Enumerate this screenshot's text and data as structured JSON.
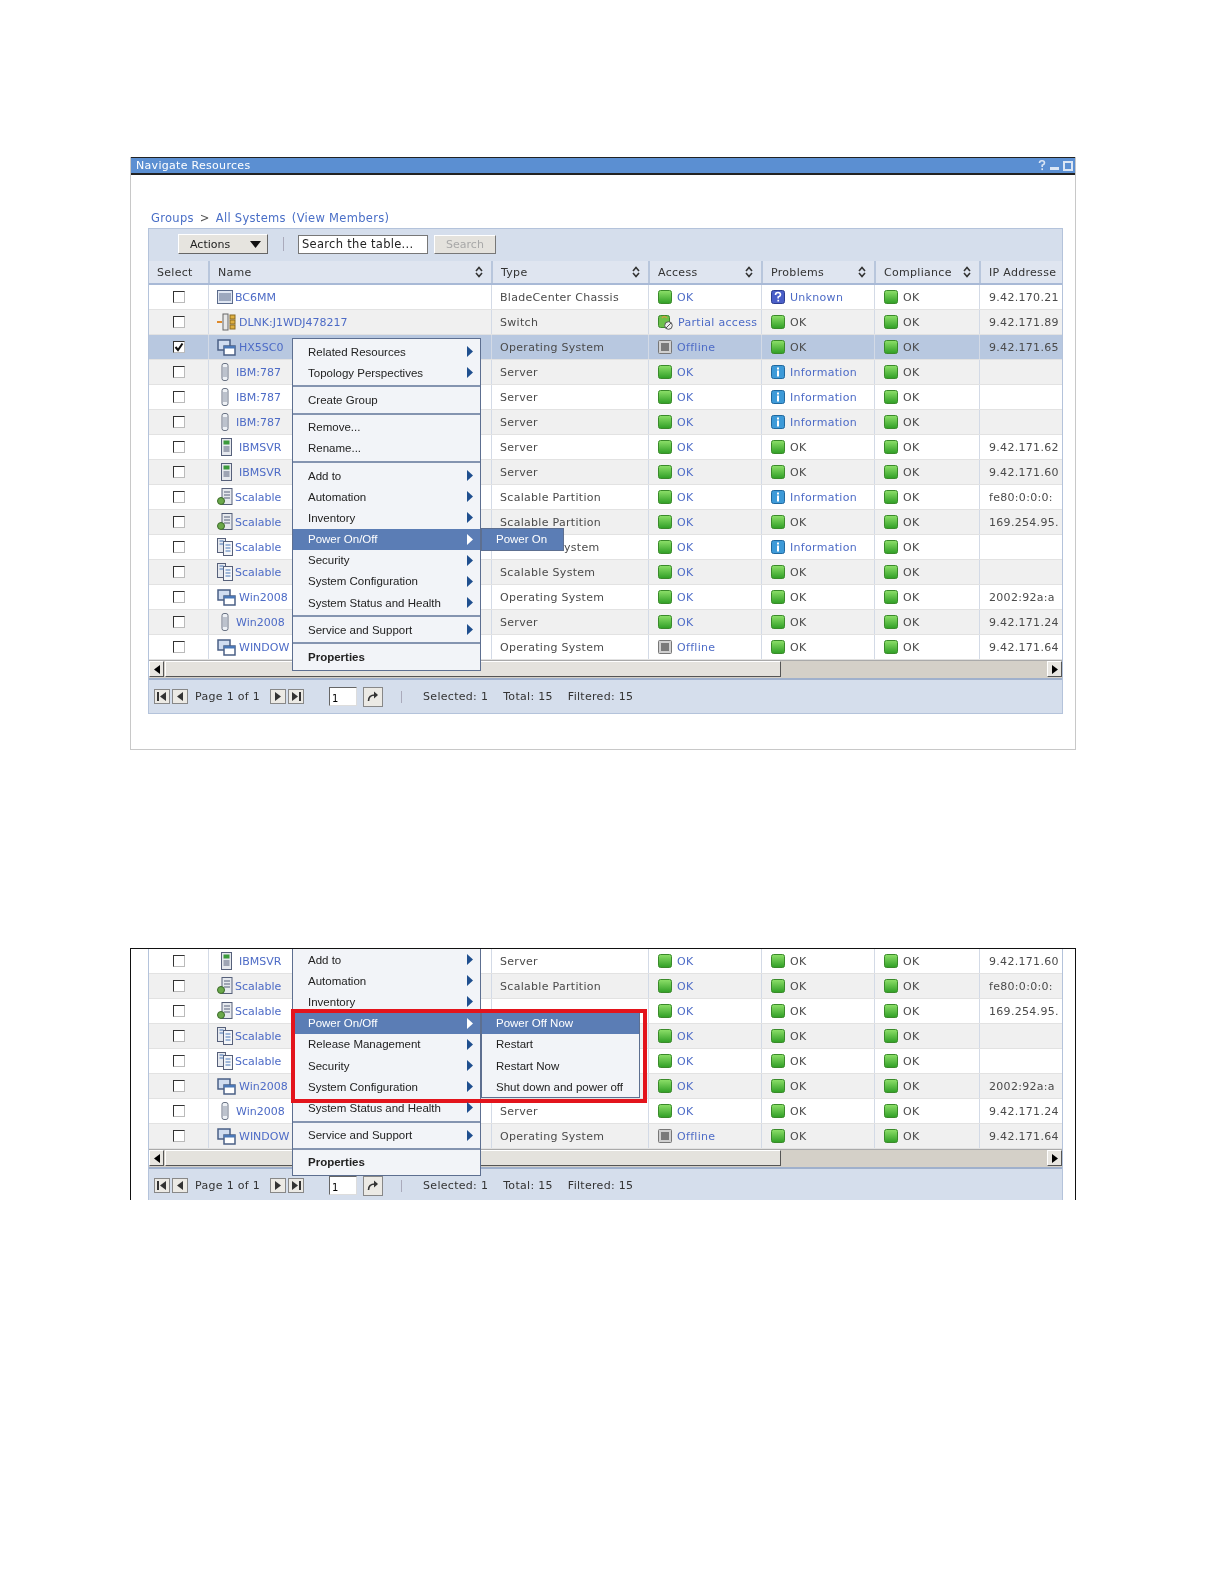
{
  "screens": [
    {
      "window": {
        "title": "Navigate Resources"
      },
      "breadcrumb": [
        {
          "text": "Groups",
          "link": true
        },
        {
          "text": ">",
          "link": false
        },
        {
          "text": "All Systems",
          "link": true
        },
        {
          "text": "(View Members)",
          "link": true
        }
      ],
      "toolbar": {
        "actions": "Actions",
        "search": {
          "placeholder": "Search the table..."
        },
        "search_button": {
          "label": "Search",
          "disabled": true
        }
      },
      "columns": [
        {
          "label": "Select",
          "sortable": false
        },
        {
          "label": "Name",
          "sortable": true
        },
        {
          "label": "Type",
          "sortable": true
        },
        {
          "label": "Access",
          "sortable": true
        },
        {
          "label": "Problems",
          "sortable": true
        },
        {
          "label": "Compliance",
          "sortable": true
        },
        {
          "label": "IP Addresse"
        }
      ],
      "rows": [
        {
          "kind": "chassis",
          "selected": false,
          "name": "BC6MM",
          "type": "BladeCenter Chassis",
          "access": {
            "kind": "ok",
            "text": "OK"
          },
          "problems": {
            "kind": "unknown",
            "text": "Unknown"
          },
          "compliance": {
            "kind": "ok",
            "text": "OK"
          },
          "ip": "9.42.170.21"
        },
        {
          "kind": "switch",
          "selected": false,
          "name": "DLNK:J1WDJ478217",
          "type": "Switch",
          "access": {
            "kind": "partial",
            "text": "Partial access"
          },
          "problems": {
            "kind": "ok",
            "text": "OK"
          },
          "compliance": {
            "kind": "ok",
            "text": "OK"
          },
          "ip": "9.42.171.89"
        },
        {
          "kind": "os",
          "selected": true,
          "name": "HX5SC0",
          "type": "Operating System",
          "access": {
            "kind": "offline",
            "text": "Offline"
          },
          "problems": {
            "kind": "ok",
            "text": "OK"
          },
          "compliance": {
            "kind": "ok",
            "text": "OK"
          },
          "ip": "9.42.171.65"
        },
        {
          "kind": "blade",
          "selected": false,
          "name": "IBM:787",
          "type": "Server",
          "access": {
            "kind": "ok",
            "text": "OK"
          },
          "problems": {
            "kind": "info",
            "text": "Information"
          },
          "compliance": {
            "kind": "ok",
            "text": "OK"
          }
        },
        {
          "kind": "blade",
          "selected": false,
          "name": "IBM:787",
          "type": "Server",
          "access": {
            "kind": "ok",
            "text": "OK"
          },
          "problems": {
            "kind": "info",
            "text": "Information"
          },
          "compliance": {
            "kind": "ok",
            "text": "OK"
          }
        },
        {
          "kind": "blade",
          "selected": false,
          "name": "IBM:787",
          "type": "Server",
          "access": {
            "kind": "ok",
            "text": "OK"
          },
          "problems": {
            "kind": "info",
            "text": "Information"
          },
          "compliance": {
            "kind": "ok",
            "text": "OK"
          }
        },
        {
          "kind": "tower",
          "selected": false,
          "name": "IBMSVR",
          "type": "Server",
          "access": {
            "kind": "ok",
            "text": "OK"
          },
          "problems": {
            "kind": "ok",
            "text": "OK"
          },
          "compliance": {
            "kind": "ok",
            "text": "OK"
          },
          "ip": "9.42.171.62"
        },
        {
          "kind": "tower",
          "selected": false,
          "name": "IBMSVR",
          "type": "Server",
          "access": {
            "kind": "ok",
            "text": "OK"
          },
          "problems": {
            "kind": "ok",
            "text": "OK"
          },
          "compliance": {
            "kind": "ok",
            "text": "OK"
          },
          "ip": "9.42.171.60"
        },
        {
          "kind": "partition",
          "selected": false,
          "name": "Scalable",
          "type": "Scalable Partition",
          "access": {
            "kind": "ok",
            "text": "OK"
          },
          "problems": {
            "kind": "info",
            "text": "Information"
          },
          "compliance": {
            "kind": "ok",
            "text": "OK"
          },
          "ip": "fe80:0:0:0:"
        },
        {
          "kind": "partition",
          "selected": false,
          "name": "Scalable",
          "type": "Scalable Partition",
          "access": {
            "kind": "ok",
            "text": "OK"
          },
          "problems": {
            "kind": "ok",
            "text": "OK"
          },
          "compliance": {
            "kind": "ok",
            "text": "OK"
          },
          "ip": "169.254.95."
        },
        {
          "kind": "system",
          "selected": false,
          "name": "Scalable",
          "type": "ystem",
          "type_partly_covered": true,
          "access": {
            "kind": "ok",
            "text": "OK"
          },
          "problems": {
            "kind": "info",
            "text": "Information"
          },
          "compliance": {
            "kind": "ok",
            "text": "OK"
          }
        },
        {
          "kind": "system",
          "selected": false,
          "name": "Scalable",
          "type": "Scalable System",
          "access": {
            "kind": "ok",
            "text": "OK"
          },
          "problems": {
            "kind": "ok",
            "text": "OK"
          },
          "compliance": {
            "kind": "ok",
            "text": "OK"
          }
        },
        {
          "kind": "os",
          "selected": false,
          "name": "Win2008",
          "type": "Operating System",
          "access": {
            "kind": "ok",
            "text": "OK"
          },
          "problems": {
            "kind": "ok",
            "text": "OK"
          },
          "compliance": {
            "kind": "ok",
            "text": "OK"
          },
          "ip": "2002:92a:a"
        },
        {
          "kind": "blade",
          "selected": false,
          "name": "Win2008",
          "type": "Server",
          "access": {
            "kind": "ok",
            "text": "OK"
          },
          "problems": {
            "kind": "ok",
            "text": "OK"
          },
          "compliance": {
            "kind": "ok",
            "text": "OK"
          },
          "ip": "9.42.171.24"
        },
        {
          "kind": "os",
          "selected": false,
          "name": "WINDOW",
          "type": "Operating System",
          "access": {
            "kind": "offline",
            "text": "Offline"
          },
          "problems": {
            "kind": "ok",
            "text": "OK"
          },
          "compliance": {
            "kind": "ok",
            "text": "OK"
          },
          "ip": "9.42.171.64"
        }
      ],
      "menu": {
        "highlight": false,
        "sections": [
          [
            {
              "label": "Related Resources",
              "has_submenu": true,
              "selected": false,
              "default": false
            },
            {
              "label": "Topology Perspectives",
              "has_submenu": true,
              "selected": false,
              "default": false
            }
          ],
          [
            {
              "label": "Create Group",
              "has_submenu": false,
              "selected": false,
              "default": false
            }
          ],
          [
            {
              "label": "Remove...",
              "has_submenu": false,
              "selected": false,
              "default": false
            },
            {
              "label": "Rename...",
              "has_submenu": false,
              "selected": false,
              "default": false
            }
          ],
          [
            {
              "label": "Add to",
              "has_submenu": true,
              "selected": false,
              "default": false
            },
            {
              "label": "Automation",
              "has_submenu": true,
              "selected": false,
              "default": false
            },
            {
              "label": "Inventory",
              "has_submenu": true,
              "selected": false,
              "default": false
            },
            {
              "label": "Power On/Off",
              "has_submenu": true,
              "selected": true,
              "default": false
            },
            {
              "label": "Security",
              "has_submenu": true,
              "selected": false,
              "default": false
            },
            {
              "label": "System Configuration",
              "has_submenu": true,
              "selected": false,
              "default": false
            },
            {
              "label": "System Status and Health",
              "has_submenu": true,
              "selected": false,
              "default": false
            }
          ],
          [
            {
              "label": "Service and Support",
              "has_submenu": true,
              "selected": false,
              "default": false
            }
          ],
          [
            {
              "label": "Properties",
              "has_submenu": false,
              "selected": false,
              "default": true
            }
          ]
        ],
        "submenu": [
          {
            "label": "Power On",
            "selected": true
          }
        ]
      },
      "pager": {
        "page_label": "Page 1 of 1",
        "page_value": "1",
        "selected_count": "Selected: 1",
        "total": "Total: 15",
        "filtered": "Filtered: 15"
      }
    },
    {
      "rows": [
        {
          "kind": "tower",
          "selected": false,
          "name": "IBMSVR",
          "type": "Server",
          "access": {
            "kind": "ok",
            "text": "OK"
          },
          "problems": {
            "kind": "ok",
            "text": "OK"
          },
          "compliance": {
            "kind": "ok",
            "text": "OK"
          },
          "ip": "9.42.171.60"
        },
        {
          "kind": "partition",
          "selected": false,
          "name": "Scalable",
          "type": "Scalable Partition",
          "access": {
            "kind": "ok",
            "text": "OK"
          },
          "problems": {
            "kind": "ok",
            "text": "OK"
          },
          "compliance": {
            "kind": "ok",
            "text": "OK"
          },
          "ip": "fe80:0:0:0:"
        },
        {
          "kind": "partition",
          "selected": false,
          "name": "Scalable",
          "access": {
            "kind": "ok",
            "text": "OK"
          },
          "problems": {
            "kind": "ok",
            "text": "OK"
          },
          "compliance": {
            "kind": "ok",
            "text": "OK"
          },
          "ip": "169.254.95."
        },
        {
          "kind": "system",
          "selected": false,
          "name": "Scalable",
          "access": {
            "kind": "ok",
            "text": "OK"
          },
          "problems": {
            "kind": "ok",
            "text": "OK"
          },
          "compliance": {
            "kind": "ok",
            "text": "OK"
          }
        },
        {
          "kind": "system",
          "selected": false,
          "name": "Scalable",
          "access": {
            "kind": "ok",
            "text": "OK"
          },
          "problems": {
            "kind": "ok",
            "text": "OK"
          },
          "compliance": {
            "kind": "ok",
            "text": "OK"
          }
        },
        {
          "kind": "os",
          "selected": false,
          "name": "Win2008",
          "access": {
            "kind": "ok",
            "text": "OK"
          },
          "problems": {
            "kind": "ok",
            "text": "OK"
          },
          "compliance": {
            "kind": "ok",
            "text": "OK"
          },
          "ip": "2002:92a:a"
        },
        {
          "kind": "blade",
          "selected": false,
          "name": "Win2008",
          "type": "Server",
          "access": {
            "kind": "ok",
            "text": "OK"
          },
          "problems": {
            "kind": "ok",
            "text": "OK"
          },
          "compliance": {
            "kind": "ok",
            "text": "OK"
          },
          "ip": "9.42.171.24"
        },
        {
          "kind": "os",
          "selected": false,
          "name": "WINDOW",
          "type": "Operating System",
          "access": {
            "kind": "offline",
            "text": "Offline"
          },
          "problems": {
            "kind": "ok",
            "text": "OK"
          },
          "compliance": {
            "kind": "ok",
            "text": "OK"
          },
          "ip": "9.42.171.64"
        }
      ],
      "menu": {
        "highlight": true,
        "sections": [
          [
            {
              "label": "Add to",
              "has_submenu": true,
              "selected": false,
              "default": false
            },
            {
              "label": "Automation",
              "has_submenu": true,
              "selected": false,
              "default": false
            },
            {
              "label": "Inventory",
              "has_submenu": true,
              "selected": false,
              "default": false
            },
            {
              "label": "Power On/Off",
              "has_submenu": true,
              "selected": true,
              "default": false
            },
            {
              "label": "Release Management",
              "has_submenu": true,
              "selected": false,
              "default": false
            },
            {
              "label": "Security",
              "has_submenu": true,
              "selected": false,
              "default": false
            },
            {
              "label": "System Configuration",
              "has_submenu": true,
              "selected": false,
              "default": false
            },
            {
              "label": "System Status and Health",
              "has_submenu": true,
              "selected": false,
              "default": false
            }
          ],
          [
            {
              "label": "Service and Support",
              "has_submenu": true,
              "selected": false,
              "default": false
            }
          ],
          [
            {
              "label": "Properties",
              "has_submenu": false,
              "selected": false,
              "default": true
            }
          ]
        ],
        "submenu": [
          {
            "label": "Power Off Now",
            "selected": true
          },
          {
            "label": "Restart",
            "selected": false
          },
          {
            "label": "Restart Now",
            "selected": false
          },
          {
            "label": "Shut down and power off",
            "selected": false
          }
        ]
      },
      "pager": {
        "page_label": "Page 1 of 1",
        "page_value": "1",
        "selected_count": "Selected: 1",
        "total": "Total: 15",
        "filtered": "Filtered: 15"
      }
    }
  ]
}
